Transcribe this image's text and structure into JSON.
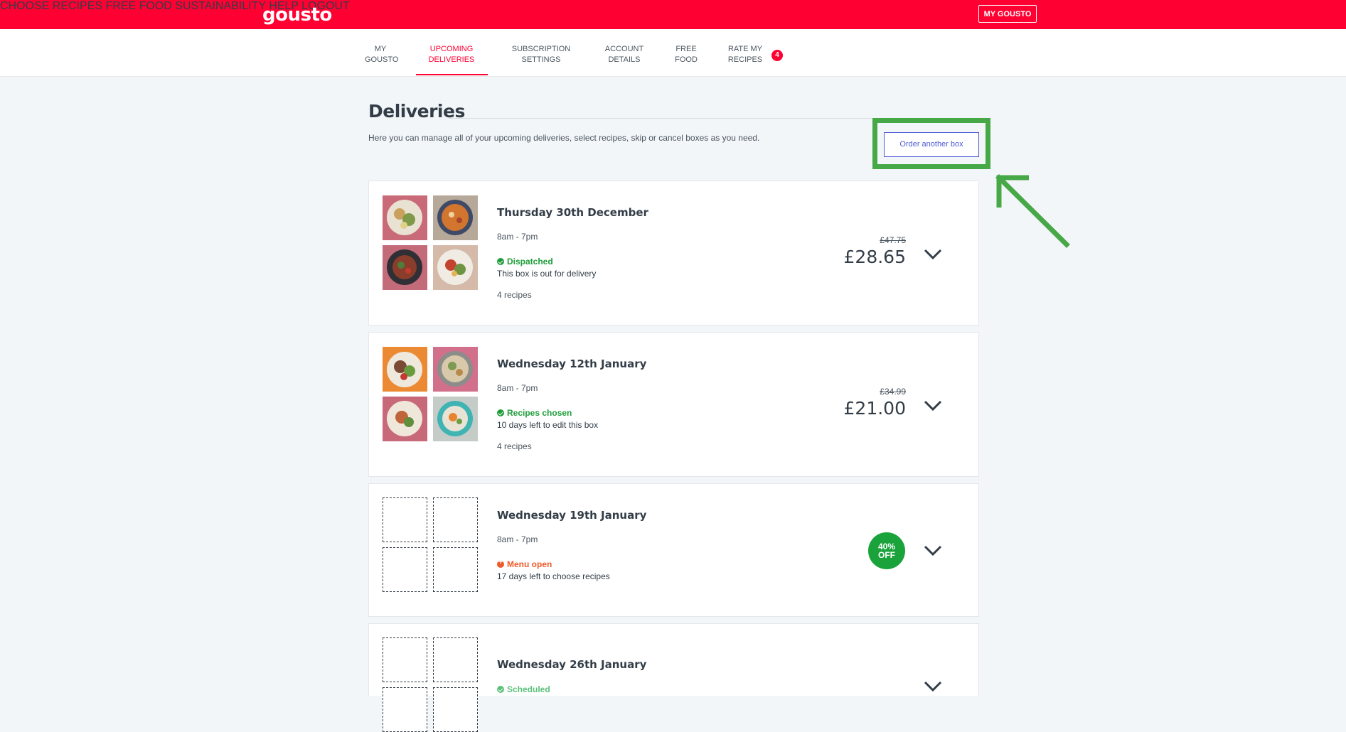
{
  "brand": {
    "logo": "gousto"
  },
  "topnav": {
    "choose_recipes": "CHOOSE RECIPES",
    "free_food": "FREE FOOD",
    "sustainability": "SUSTAINABILITY",
    "help": "HELP",
    "my_gousto": "MY GOUSTO",
    "logout": "LOGOUT"
  },
  "subnav": {
    "tabs": [
      {
        "line1": "MY",
        "line2": "GOUSTO"
      },
      {
        "line1": "UPCOMING",
        "line2": "DELIVERIES"
      },
      {
        "line1": "SUBSCRIPTION",
        "line2": "SETTINGS"
      },
      {
        "line1": "ACCOUNT",
        "line2": "DETAILS"
      },
      {
        "line1": "FREE",
        "line2": "FOOD"
      },
      {
        "line1": "RATE MY",
        "line2": "RECIPES"
      }
    ],
    "rate_badge": "4"
  },
  "page": {
    "title": "Deliveries",
    "intro": "Here you can manage all of your upcoming deliveries, select recipes, skip or cancel boxes as you need.",
    "order_button": "Order another box"
  },
  "deliveries": [
    {
      "date": "Thursday 30th December",
      "time": "8am - 7pm",
      "status": "Dispatched",
      "substatus": "This box is out for delivery",
      "recipes": "4 recipes",
      "old_price": "£47.75",
      "price": "£28.65"
    },
    {
      "date": "Wednesday 12th January",
      "time": "8am - 7pm",
      "status": "Recipes chosen",
      "substatus": "10 days left to edit this box",
      "recipes": "4 recipes",
      "old_price": "£34.99",
      "price": "£21.00"
    },
    {
      "date": "Wednesday 19th January",
      "time": "8am - 7pm",
      "status": "Menu open",
      "substatus": "17 days left to choose recipes",
      "discount_line1": "40%",
      "discount_line2": "OFF"
    },
    {
      "date": "Wednesday 26th January",
      "status": "Scheduled"
    }
  ],
  "colors": {
    "brand_red": "#ff0032",
    "highlight_green": "#47a848",
    "status_green": "#1f9d3a",
    "status_orange": "#f05a28",
    "link_blue": "#4d5bd6"
  }
}
